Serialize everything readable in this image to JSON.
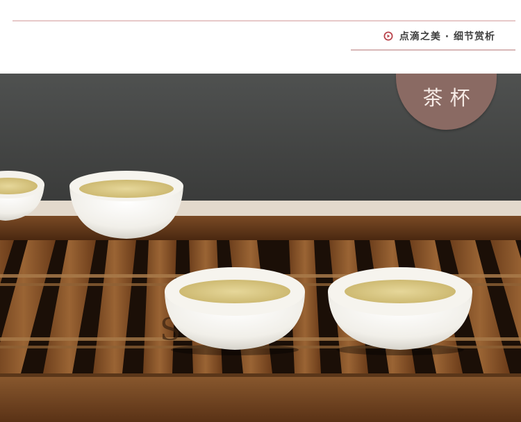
{
  "header": {
    "section_label": "点滴之美 · 细节赏析",
    "icon": "circle-play-icon",
    "accent_color": "#b9434b"
  },
  "badge": {
    "title": "茶杯",
    "color": "#8a6a63"
  },
  "photo": {
    "subject": "white-porcelain-tea-cups-on-wooden-tea-tray",
    "cup_count": 4
  }
}
